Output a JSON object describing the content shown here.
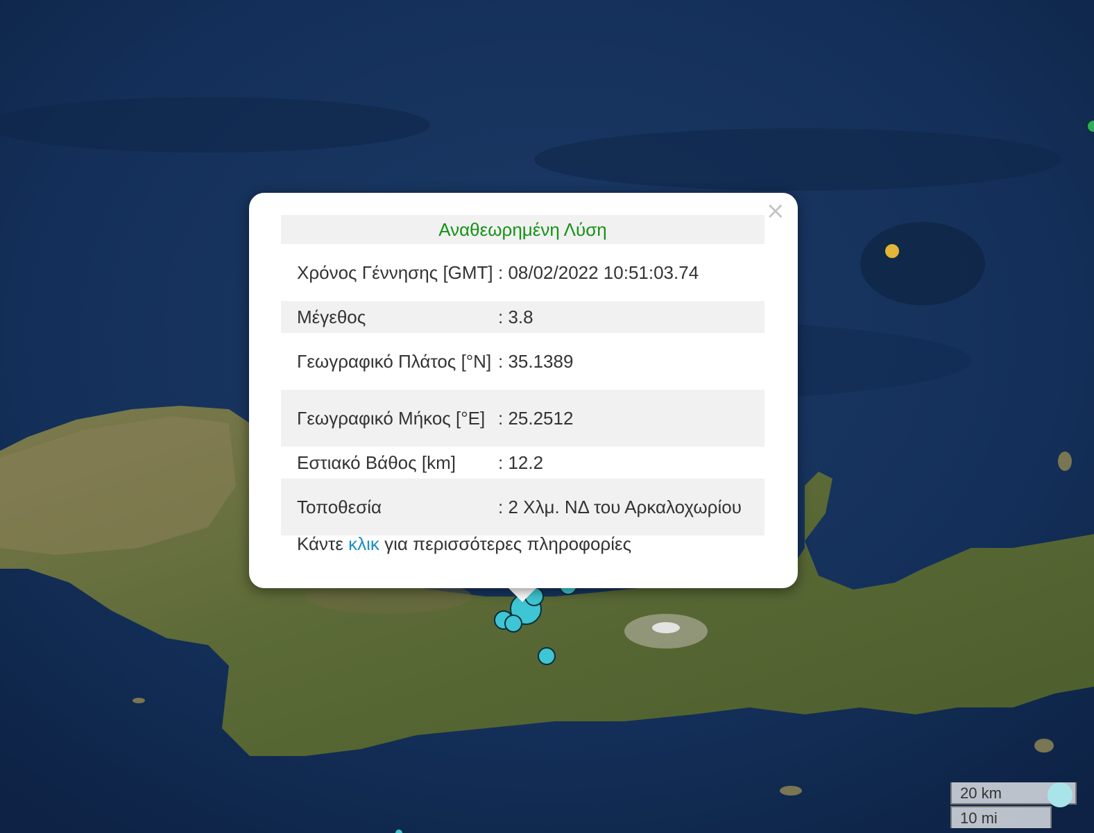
{
  "popup": {
    "title": "Αναθεωρημένη Λύση",
    "title_color": "#169116",
    "rows": [
      {
        "label": "Χρόνος Γέννησης [GMT]",
        "value": ": 08/02/2022 10:51:03.74"
      },
      {
        "label": "Μέγεθος",
        "value": ": 3.8"
      },
      {
        "label": "Γεωγραφικό Πλάτος [°N]",
        "value": ": 35.1389"
      },
      {
        "label": "Γεωγραφικό Μήκος [°E]",
        "value": ": 25.2512"
      },
      {
        "label": "Εστιακό Βάθος [km]",
        "value": ": 12.2"
      },
      {
        "label": "Τοποθεσία",
        "value": ": 2 Χλμ. ΝΔ του Αρκαλοχωρίου"
      }
    ],
    "footer_prefix": "Κάντε ",
    "footer_link": "κλικ",
    "footer_suffix": " για περισσότερες πληροφορίες",
    "close_glyph": "×"
  },
  "scale": {
    "km_label": "20 km",
    "mi_label": "10 mi"
  },
  "markers": {
    "recent_color": "#3ec6d4",
    "older_color": "#e3b43a",
    "other_color": "#2fae5a"
  }
}
